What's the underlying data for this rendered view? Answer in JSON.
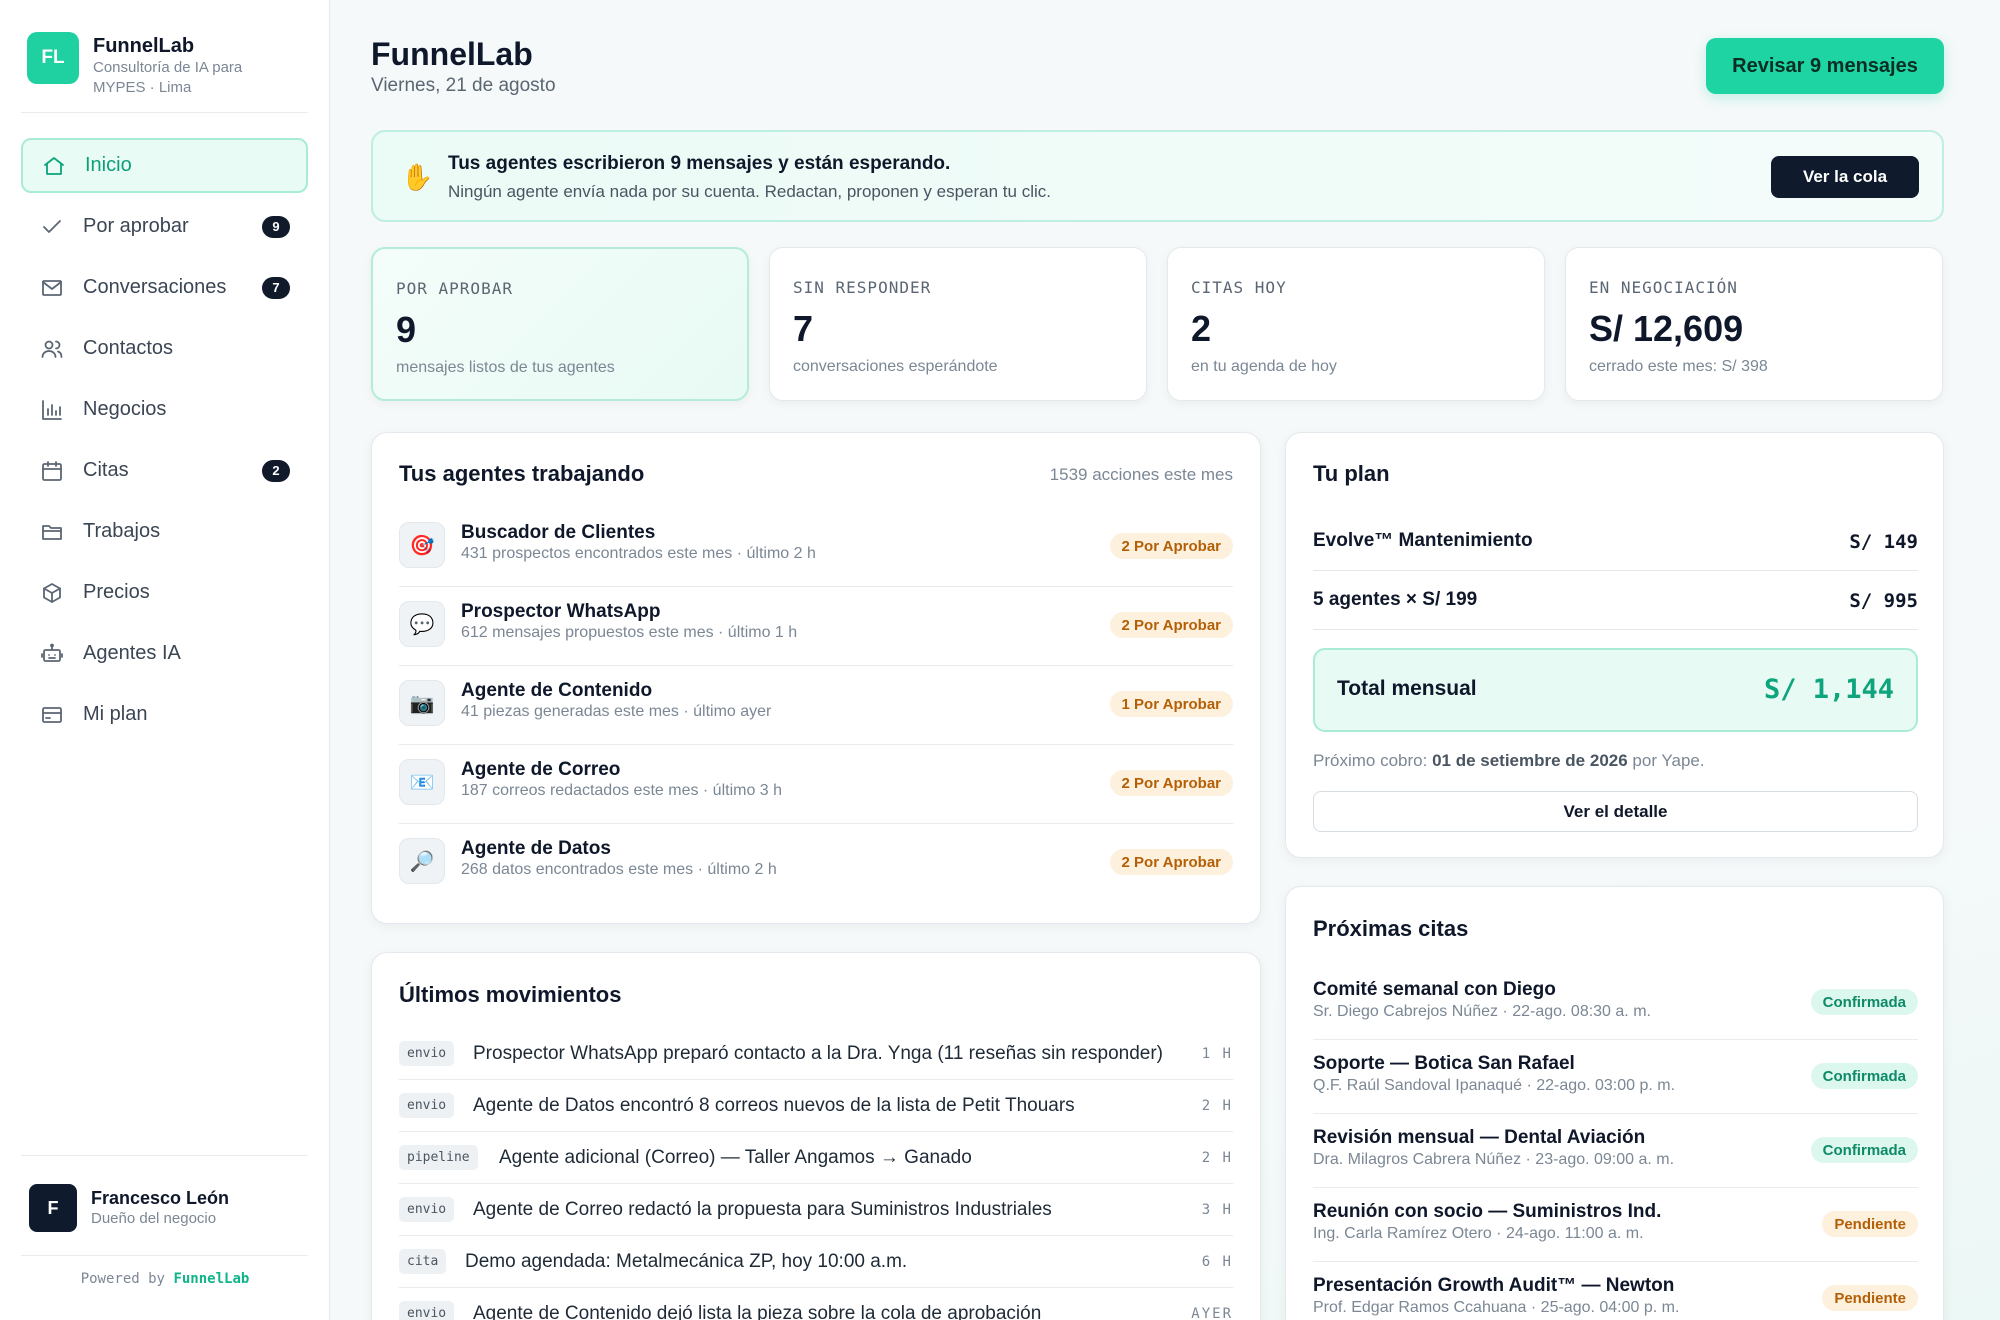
{
  "brand": {
    "logo": "FL",
    "name": "FunnelLab",
    "subtitle": "Consultoría de IA para MYPES · Lima"
  },
  "nav": [
    {
      "label": "Inicio",
      "icon": "home-icon",
      "badge": null,
      "active": true
    },
    {
      "label": "Por aprobar",
      "icon": "check-icon",
      "badge": "9",
      "active": false
    },
    {
      "label": "Conversaciones",
      "icon": "mail-icon",
      "badge": "7",
      "active": false
    },
    {
      "label": "Contactos",
      "icon": "users-icon",
      "badge": null,
      "active": false
    },
    {
      "label": "Negocios",
      "icon": "bar-chart-icon",
      "badge": null,
      "active": false
    },
    {
      "label": "Citas",
      "icon": "calendar-icon",
      "badge": "2",
      "active": false
    },
    {
      "label": "Trabajos",
      "icon": "folder-icon",
      "badge": null,
      "active": false
    },
    {
      "label": "Precios",
      "icon": "box-icon",
      "badge": null,
      "active": false
    },
    {
      "label": "Agentes IA",
      "icon": "robot-icon",
      "badge": null,
      "active": false
    },
    {
      "label": "Mi plan",
      "icon": "credit-card-icon",
      "badge": null,
      "active": false
    }
  ],
  "user": {
    "initial": "F",
    "name": "Francesco León",
    "role": "Dueño del negocio"
  },
  "powered": {
    "prefix": "Powered by",
    "brand": "FunnelLab"
  },
  "header": {
    "title": "FunnelLab",
    "date": "Viernes, 21 de agosto",
    "primary_button": "Revisar 9 mensajes"
  },
  "alert": {
    "icon": "raised-hand-icon",
    "title": "Tus agentes escribieron 9 mensajes y están esperando.",
    "subtitle": "Ningún agente envía nada por su cuenta. Redactan, proponen y esperan tu clic.",
    "button": "Ver la cola"
  },
  "stats": [
    {
      "label": "POR APROBAR",
      "value": "9",
      "sub": "mensajes listos de tus agentes",
      "highlight": true
    },
    {
      "label": "SIN RESPONDER",
      "value": "7",
      "sub": "conversaciones esperándote",
      "highlight": false
    },
    {
      "label": "CITAS HOY",
      "value": "2",
      "sub": "en tu agenda de hoy",
      "highlight": false
    },
    {
      "label": "EN NEGOCIACIÓN",
      "value": "S/ 12,609",
      "sub": "cerrado este mes: S/ 398",
      "highlight": false
    }
  ],
  "agents": {
    "title": "Tus agentes trabajando",
    "meta": "1539 acciones este mes",
    "items": [
      {
        "icon": "target-icon",
        "glyph": "🎯",
        "name": "Buscador de Clientes",
        "desc": "431 prospectos encontrados este mes · último 2 h",
        "badge": "2 Por Aprobar"
      },
      {
        "icon": "speech-bubble-icon",
        "glyph": "💬",
        "name": "Prospector WhatsApp",
        "desc": "612 mensajes propuestos este mes · último 1 h",
        "badge": "2 Por Aprobar"
      },
      {
        "icon": "camera-icon",
        "glyph": "📷",
        "name": "Agente de Contenido",
        "desc": "41 piezas generadas este mes · último ayer",
        "badge": "1 Por Aprobar"
      },
      {
        "icon": "envelope-icon",
        "glyph": "📧",
        "name": "Agente de Correo",
        "desc": "187 correos redactados este mes · último 3 h",
        "badge": "2 Por Aprobar"
      },
      {
        "icon": "magnifier-icon",
        "glyph": "🔎",
        "name": "Agente de Datos",
        "desc": "268 datos encontrados este mes · último 2 h",
        "badge": "2 Por Aprobar"
      }
    ]
  },
  "movements": {
    "title": "Últimos movimientos",
    "items": [
      {
        "tag": "envio",
        "text": "Prospector WhatsApp preparó contacto a la Dra. Ynga (11 reseñas sin responder)",
        "time": "1 H"
      },
      {
        "tag": "envio",
        "text": "Agente de Datos encontró 8 correos nuevos de la lista de Petit Thouars",
        "time": "2 H"
      },
      {
        "tag": "pipeline",
        "text": "Agente adicional (Correo) — Taller Angamos → Ganado",
        "time": "2 H"
      },
      {
        "tag": "envio",
        "text": "Agente de Correo redactó la propuesta para Suministros Industriales",
        "time": "3 H"
      },
      {
        "tag": "cita",
        "text": "Demo agendada: Metalmecánica ZP, hoy 10:00 a.m.",
        "time": "6 H"
      },
      {
        "tag": "envio",
        "text": "Agente de Contenido dejó lista la pieza sobre la cola de aprobación",
        "time": "AYER"
      }
    ]
  },
  "plan": {
    "title": "Tu plan",
    "lines": [
      {
        "label": "Evolve™ Mantenimiento",
        "amount": "S/  149"
      },
      {
        "label": "5 agentes × S/ 199",
        "amount": "S/  995"
      }
    ],
    "total_label": "Total mensual",
    "total_amount": "S/ 1,144",
    "next_prefix": "Próximo cobro:",
    "next_date": "01 de setiembre de 2026",
    "next_suffix": "por Yape.",
    "button": "Ver el detalle"
  },
  "citas": {
    "title": "Próximas citas",
    "items": [
      {
        "title": "Comité semanal con Diego",
        "sub": "Sr. Diego Cabrejos Núñez · 22-ago. 08:30 a. m.",
        "status": "Confirmada",
        "kind": "ok"
      },
      {
        "title": "Soporte — Botica San Rafael",
        "sub": "Q.F. Raúl Sandoval Ipanaqué · 22-ago. 03:00 p. m.",
        "status": "Confirmada",
        "kind": "ok"
      },
      {
        "title": "Revisión mensual — Dental Aviación",
        "sub": "Dra. Milagros Cabrera Núñez · 23-ago. 09:00 a. m.",
        "status": "Confirmada",
        "kind": "ok"
      },
      {
        "title": "Reunión con socio — Suministros Ind.",
        "sub": "Ing. Carla Ramírez Otero · 24-ago. 11:00 a. m.",
        "status": "Pendiente",
        "kind": "pend"
      },
      {
        "title": "Presentación Growth Audit™ — Newton",
        "sub": "Prof. Edgar Ramos Ccahuana · 25-ago. 04:00 p. m.",
        "status": "Pendiente",
        "kind": "pend"
      }
    ]
  },
  "colors": {
    "accent": "#1fd4a3",
    "accent_dark": "#0ea47c",
    "navy": "#0f1b2d",
    "warn": "#b45f06"
  }
}
